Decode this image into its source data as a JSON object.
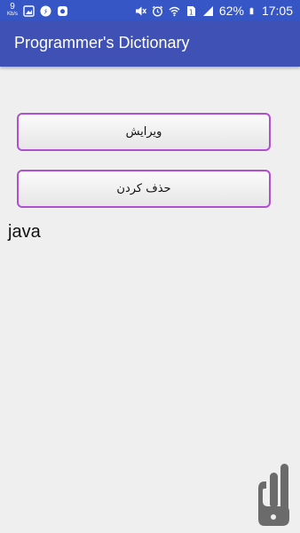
{
  "status_bar": {
    "speed_value": "9",
    "speed_unit": "Kb/s",
    "battery_percent": "62%",
    "time": "17:05",
    "left_icons": [
      "image-icon",
      "notification-badge-icon",
      "camera-app-icon"
    ],
    "right_icons": [
      "mute-icon",
      "alarm-icon",
      "wifi-icon",
      "sim-1-icon",
      "signal-icon",
      "battery-icon"
    ]
  },
  "app_bar": {
    "title": "Programmer's Dictionary"
  },
  "actions": {
    "edit_label": "ویرایش",
    "delete_label": "حذف کردن"
  },
  "entry": {
    "word": "java"
  },
  "colors": {
    "status_bar": "#3556c4",
    "app_bar": "#3f51b5",
    "button_border": "#b04fd0",
    "background": "#efefef"
  }
}
